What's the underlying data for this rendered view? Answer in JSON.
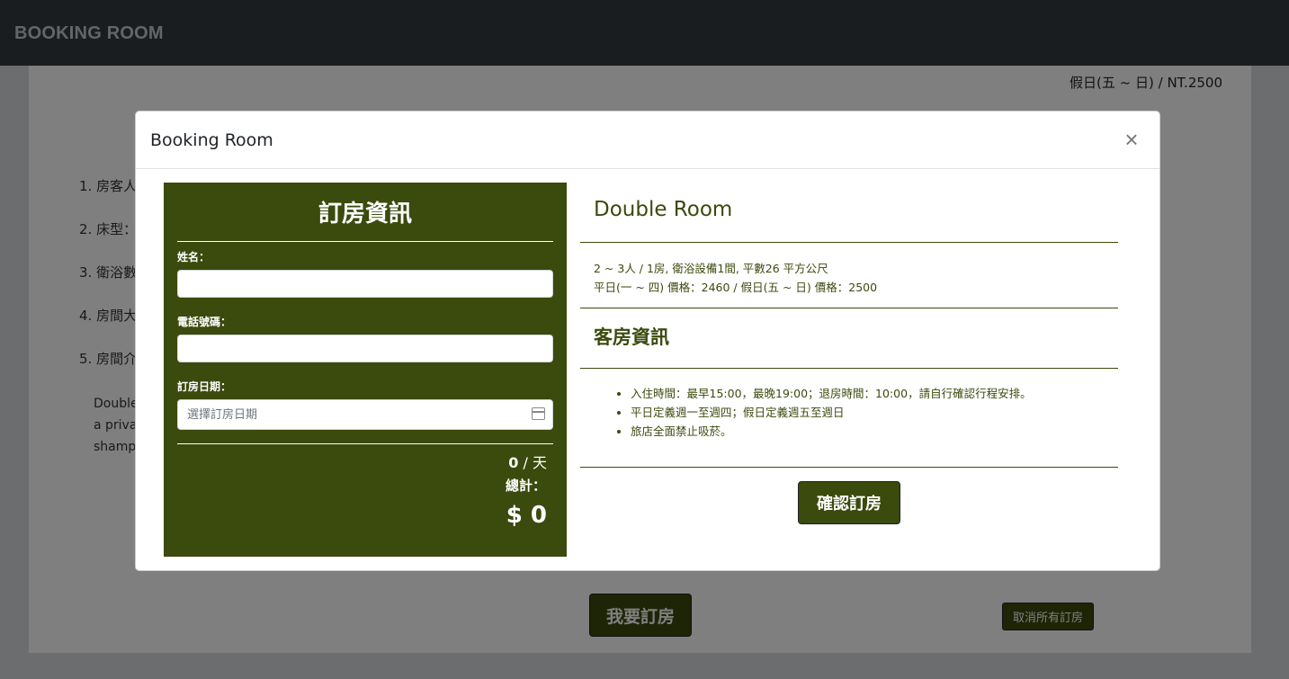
{
  "navbar": {
    "brand": "BOOKING ROOM"
  },
  "page": {
    "weekend_price": "假日(五 ~ 日) / NT.2500",
    "details": [
      "1. 房客人",
      "2. 床型：",
      "3. 衛浴數",
      "4. 房間大",
      "5. 房間介"
    ],
    "description_lines": [
      "Double",
      "a priva",
      "shamp"
    ],
    "book_button": "我要訂房",
    "cancel_all_button": "取消所有訂房"
  },
  "modal": {
    "title": "Booking Room",
    "close_glyph": "×",
    "form": {
      "title": "訂房資訊",
      "name_label": "姓名：",
      "name_value": "",
      "phone_label": "電話號碼：",
      "phone_value": "",
      "date_label": "訂房日期：",
      "date_placeholder": "選擇訂房日期",
      "calendar_icon": "calendar-icon",
      "per_day_value": "0",
      "per_day_unit": "/ 天",
      "total_label": "總計：",
      "total_amount": "$ 0"
    },
    "info": {
      "room_name": "Double Room",
      "spec_line1": "2 ~ 3人 / 1房, 衛浴設備1間, 平數26 平方公尺",
      "spec_line2": "平日(一 ~ 四) 價格：2460 / 假日(五 ~ 日) 價格：2500",
      "section_title": "客房資訊",
      "rules": [
        "入住時間：最早15:00，最晚19:00；退房時間：10:00，請自行確認行程安排。",
        "平日定義週一至週四；假日定義週五至週日",
        "旅店全面禁止吸菸。"
      ],
      "confirm_button": "確認訂房"
    }
  },
  "colors": {
    "accent": "#3b4a0d",
    "navbar": "#343a40",
    "backdrop": "rgba(0,0,0,0.5)"
  }
}
